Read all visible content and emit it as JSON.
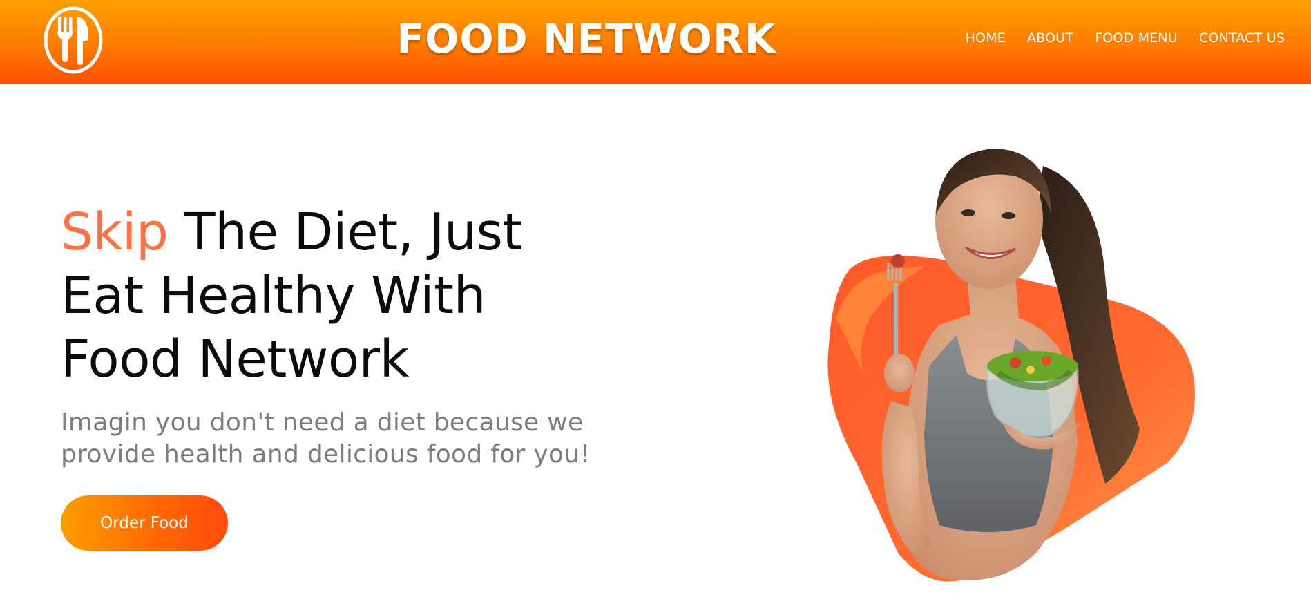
{
  "header": {
    "brand": "FOOD NETWORK",
    "logo_icon": "fork-knife-icon",
    "nav": [
      {
        "label": "HOME"
      },
      {
        "label": "ABOUT"
      },
      {
        "label": "FOOD MENU"
      },
      {
        "label": "CONTACT US"
      }
    ]
  },
  "hero": {
    "headline_accent": "Skip",
    "headline_line1_rest": " The Diet, Just",
    "headline_line2": "Eat Healthy With",
    "headline_line3": "Food Network",
    "subtext_line1": "Imagin you don't need a diet because we",
    "subtext_line2": "provide health and delicious food for you!",
    "cta_label": "Order Food",
    "image_subject": "woman-eating-salad-image"
  },
  "colors": {
    "header_gradient_top": "#ffa100",
    "header_gradient_bottom": "#ff4f00",
    "accent": "#ff7043",
    "headline": "#0b0b0b",
    "subtext": "#7d7d7d",
    "button_gradient_start": "#ff9d00",
    "button_gradient_end": "#ff4a10"
  }
}
